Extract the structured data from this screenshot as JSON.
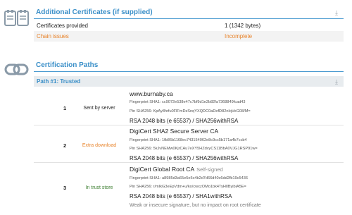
{
  "additional": {
    "title": "Additional Certificates (if supplied)",
    "rows": [
      {
        "key": "Certificates provided",
        "value": "1 (1342 bytes)"
      },
      {
        "key": "Chain issues",
        "value": "Incomplete"
      }
    ]
  },
  "paths": {
    "title": "Certification Paths",
    "path1_label": "Path #1: Trusted",
    "certs": [
      {
        "num": "1",
        "trust": "Sent by server",
        "name": "www.burnaby.ca",
        "self": "",
        "sha1": "Fingerprint SHA1: cc9072e538e47c7bf9d1e2b82fa7368849fcad43",
        "pin": "Pin SHA256: KpAy8hrfu0FlFmDzSnqYXQDC0aDefD82nIqVeG08/M=",
        "algo": "RSA 2048 bits (e 65537) / SHA256withRSA",
        "note": ""
      },
      {
        "num": "2",
        "trust": "Extra download",
        "name": "DigiCert SHA2 Secure Server CA",
        "self": "",
        "sha1": "Fingerprint SHA1: 1fb86b1168ec743154062e8c9cc5b171a4b7ccb4",
        "pin": "Pin SHA256: 5kJvNEMw0KjrCAu7eXY5HZdvyCS11BbA0VJG1RSP91w=",
        "algo": "RSA 2048 bits (e 65537) / SHA256withRSA",
        "note": ""
      },
      {
        "num": "3",
        "trust": "In trust store",
        "name": "DigiCert Global Root CA",
        "self": "Self-signed",
        "sha1": "Fingerprint SHA1: a8985d3a65e5e5c4b2d7d66d40c6dd2fb19c5436",
        "pin": "Pin SHA256: r/mIkG3eEpVdm+u/ko/cwxzOMo1bk4TyHIlByibiA5E=",
        "algo": "RSA 2048 bits (e 65537) / SHA1withRSA",
        "note": "Weak or insecure signature, but no impact on root certificate"
      }
    ]
  },
  "colors": {
    "accent": "#3a8fc8",
    "warning": "#e8832a",
    "trusted": "#3a7d2e"
  },
  "icons": [
    "certificates-icon",
    "chain-link-icon",
    "download-icon"
  ]
}
